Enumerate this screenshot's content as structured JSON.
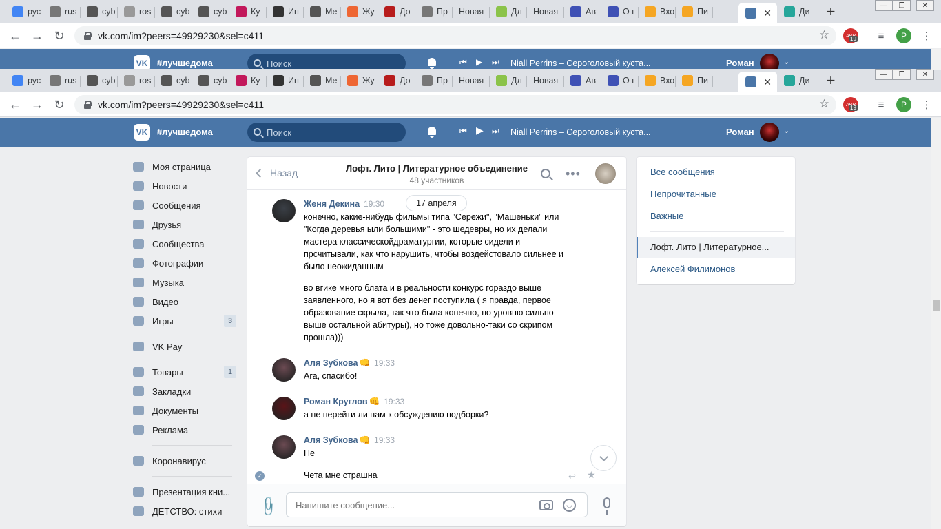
{
  "browser": {
    "tabs": [
      {
        "label": "рус",
        "icon": "google-icon",
        "color": "#4285f4"
      },
      {
        "label": "rus",
        "icon": "gray-circle-icon",
        "color": "#777777"
      },
      {
        "label": "cyb",
        "icon": "puzzle-icon",
        "color": "#555555"
      },
      {
        "label": "ros",
        "icon": "bottle-icon",
        "color": "#999999"
      },
      {
        "label": "cyb",
        "icon": "puzzle-icon",
        "color": "#555555"
      },
      {
        "label": "cyb",
        "icon": "puzzle-icon",
        "color": "#555555"
      },
      {
        "label": "Ку",
        "icon": "h-letter-icon",
        "color": "#c2185b"
      },
      {
        "label": "Ин",
        "icon": "wikipedia-icon",
        "color": "#333333"
      },
      {
        "label": "Ме",
        "icon": "puzzle-icon",
        "color": "#555555"
      },
      {
        "label": "Жу",
        "icon": "orange-c-icon",
        "color": "#ee6633"
      },
      {
        "label": "До",
        "icon": "kremlin-icon",
        "color": "#b71c1c"
      },
      {
        "label": "Пр",
        "icon": "document-icon",
        "color": "#777777"
      },
      {
        "label": "Новая",
        "icon": "",
        "color": ""
      },
      {
        "label": "Дл",
        "icon": "m-logo-icon",
        "color": "#8bc34a"
      },
      {
        "label": "Новая",
        "icon": "",
        "color": ""
      },
      {
        "label": "Ав",
        "icon": "octopus-icon",
        "color": "#3f51b5"
      },
      {
        "label": "О г",
        "icon": "octopus-icon",
        "color": "#3f51b5"
      },
      {
        "label": "Вхо",
        "icon": "mail-icon",
        "color": "#f5a623"
      },
      {
        "label": "Пи",
        "icon": "mail-icon",
        "color": "#f5a623"
      },
      {
        "label": "",
        "icon": "vk-message-icon",
        "color": "#4a76a8",
        "active": true
      },
      {
        "label": "Ди",
        "icon": "eye-icon",
        "color": "#26a69a"
      }
    ],
    "url": "vk.com/im?peers=49929230&sel=c411",
    "ext_badge": "19",
    "profile_letter": "P"
  },
  "vk": {
    "hashtag": "#лучшедома",
    "search_placeholder": "Поиск",
    "track": "Niall Perrins – Сероголовый куста...",
    "user": "Роман"
  },
  "menu": [
    {
      "label": "Моя страница",
      "icon": "home-icon"
    },
    {
      "label": "Новости",
      "icon": "news-icon"
    },
    {
      "label": "Сообщения",
      "icon": "messages-icon"
    },
    {
      "label": "Друзья",
      "icon": "friends-icon"
    },
    {
      "label": "Сообщества",
      "icon": "communities-icon"
    },
    {
      "label": "Фотографии",
      "icon": "camera-icon"
    },
    {
      "label": "Музыка",
      "icon": "music-icon"
    },
    {
      "label": "Видео",
      "icon": "video-icon"
    },
    {
      "label": "Игры",
      "icon": "gamepad-icon",
      "count": "3"
    }
  ],
  "menu2": [
    {
      "label": "VK Pay",
      "icon": "vkpay-icon"
    }
  ],
  "menu3": [
    {
      "label": "Товары",
      "icon": "bag-icon",
      "count": "1"
    },
    {
      "label": "Закладки",
      "icon": "star-icon"
    },
    {
      "label": "Документы",
      "icon": "document-icon"
    },
    {
      "label": "Реклама",
      "icon": "megaphone-icon"
    }
  ],
  "menu4": [
    {
      "label": "Коронавирус",
      "icon": "virus-icon"
    }
  ],
  "menu5": [
    {
      "label": "Презентация кни...",
      "icon": "group-icon"
    },
    {
      "label": "ДЕТСТВО: стихи",
      "icon": "group-icon"
    }
  ],
  "chat": {
    "back_label": "Назад",
    "title": "Лофт. Лито | Литературное объединение",
    "subtitle": "48 участников",
    "date_pill": "17 апреля",
    "messages": [
      {
        "author": "Женя Декина",
        "emoji": "",
        "time": "19:30",
        "avatar_color": "#3a3f46",
        "paragraphs": [
          "конечно, какие-нибудь фильмы типа \"Сережи\", \"Машеньки\" или \"Когда деревья ыли большими\" - это шедевры, но их делали мастера классическойдраматургии, которые сидели и прсчитывали, как что нарушить, чтобы воздейстовало сильнее и было неожиданным",
          "во вгике много блата и в реальности конкурс гораздо выше заявленного, но я вот без денег поступила ( я правда, первое образование скрыла, так что была конечно, по уровню сильно выше остальной абитуры), но тоже довольно-таки со скрипом прошла)))"
        ]
      },
      {
        "author": "Аля Зубкова",
        "emoji": "👊",
        "time": "19:33",
        "avatar_color": "#6b4a52",
        "paragraphs": [
          "Ага, спасибо!"
        ]
      },
      {
        "author": "Роман Круглов",
        "emoji": "👊",
        "time": "19:33",
        "avatar_color": "#5a1418",
        "paragraphs": [
          "а не перейти ли нам к обсуждению подборки?"
        ]
      },
      {
        "author": "Аля Зубкова",
        "emoji": "👊",
        "time": "19:33",
        "avatar_color": "#6b4a52",
        "paragraphs": [
          "Не"
        ]
      }
    ],
    "last_line": "Чета мне страшна",
    "composer_placeholder": "Напишите сообщение..."
  },
  "right_panel": {
    "items": [
      "Все сообщения",
      "Непрочитанные",
      "Важные"
    ],
    "dialogs": [
      "Лофт. Лито | Литературное...",
      "Алексей Филимонов"
    ]
  }
}
